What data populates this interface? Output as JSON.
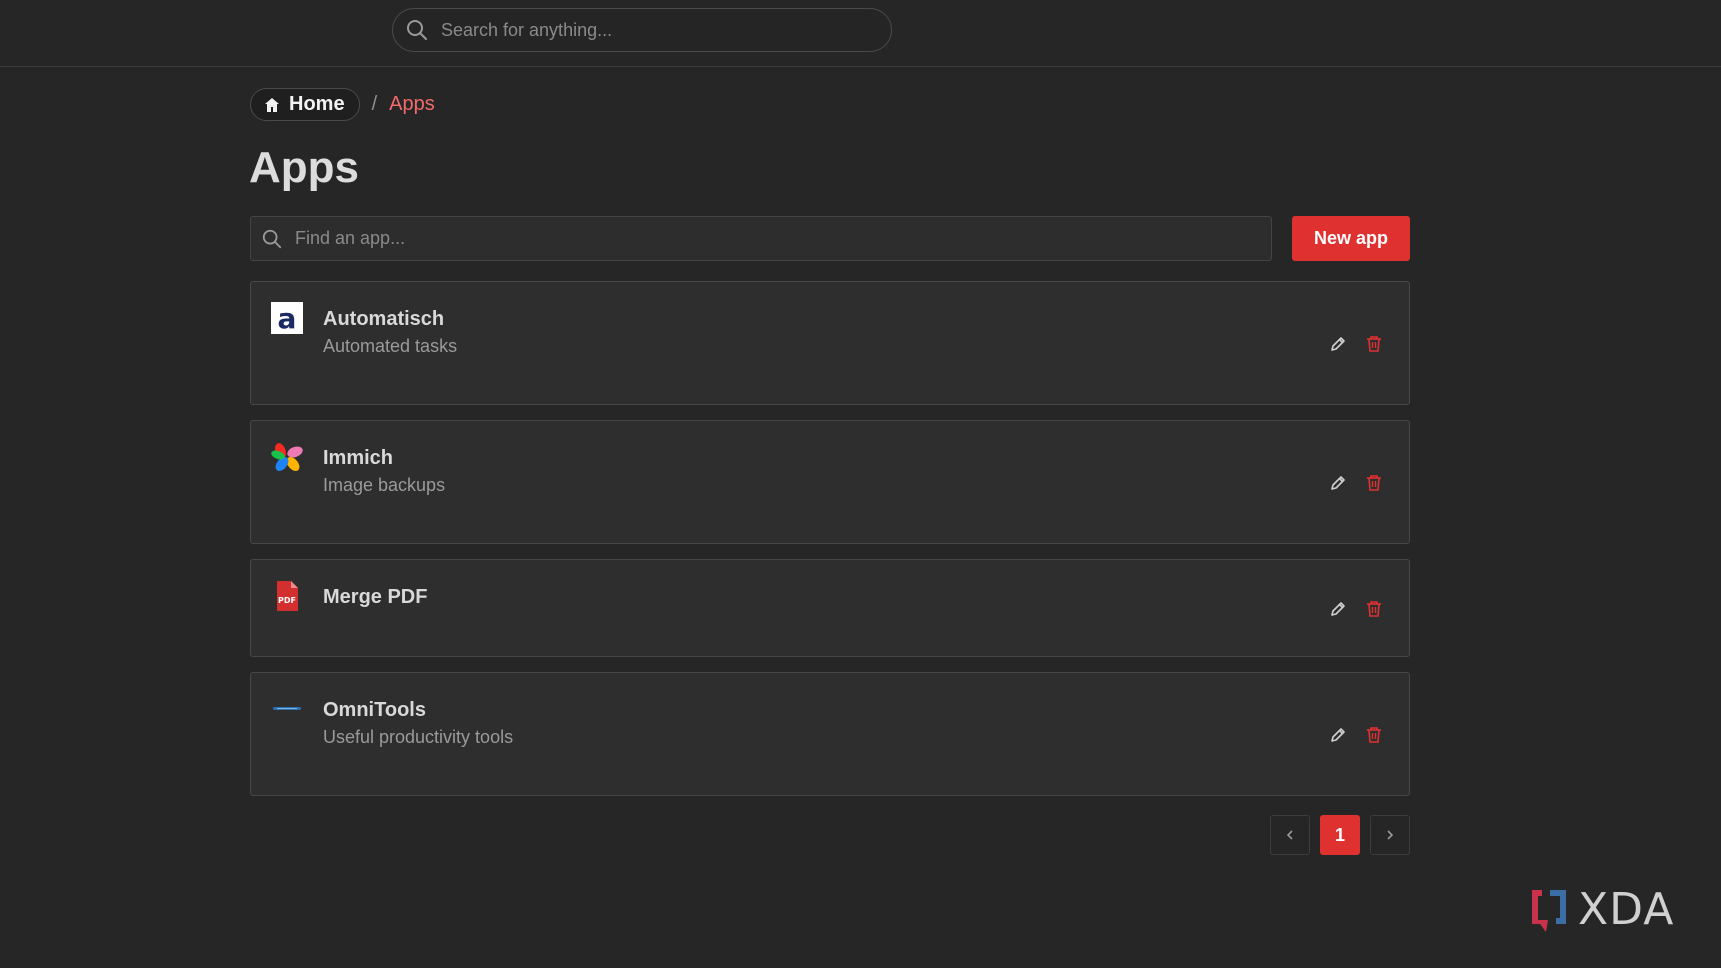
{
  "header": {
    "search_placeholder": "Search for anything..."
  },
  "breadcrumb": {
    "home_label": "Home",
    "separator": "/",
    "current_label": "Apps"
  },
  "page": {
    "title": "Apps",
    "find_placeholder": "Find an app...",
    "new_app_label": "New app"
  },
  "apps": [
    {
      "name": "Automatisch",
      "description": "Automated tasks",
      "icon": "automatisch-logo-icon"
    },
    {
      "name": "Immich",
      "description": "Image backups",
      "icon": "immich-logo-icon"
    },
    {
      "name": "Merge PDF",
      "description": "",
      "icon": "pdf-file-icon"
    },
    {
      "name": "OmniTools",
      "description": "Useful productivity tools",
      "icon": "omnitools-logo-icon"
    }
  ],
  "pagination": {
    "current_page": "1"
  },
  "watermark": {
    "text": "XDA"
  },
  "colors": {
    "accent": "#e03131",
    "breadcrumb_current": "#f26b6b",
    "background": "#262626",
    "card": "#2e2e2e"
  }
}
